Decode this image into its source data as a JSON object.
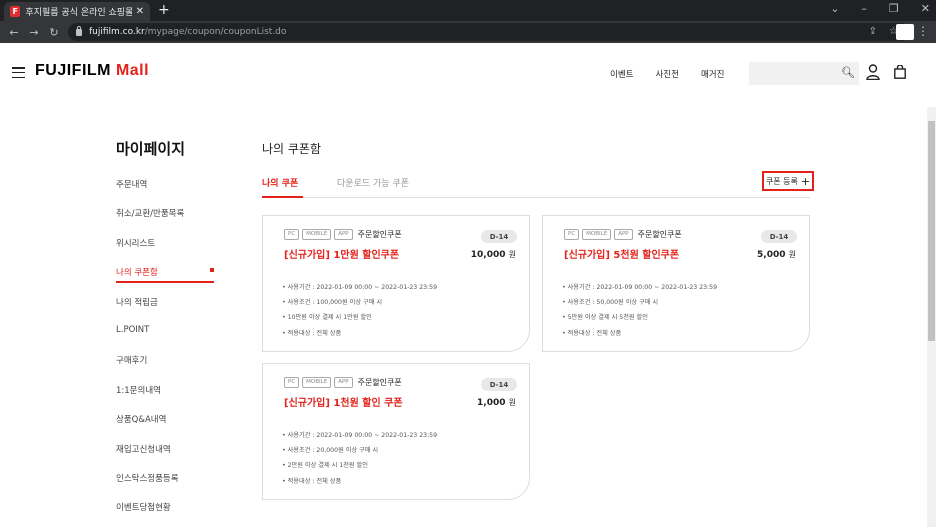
{
  "browser": {
    "tab_title": "후지필름 공식 온라인 쇼핑몰, 포",
    "favicon_letter": "F",
    "url_host": "fujifilm.co.kr",
    "url_path": "/mypage/coupon/couponList.do"
  },
  "header": {
    "logo_text": "FUJIFILM",
    "logo_mall": "Mall",
    "nav": [
      "이벤트",
      "사진전",
      "매거진"
    ],
    "accent_color": "#e3231b"
  },
  "sidebar": {
    "title": "마이페이지",
    "items": [
      "주문내역",
      "취소/교환/반품목록",
      "위시리스트",
      "나의 쿠폰함",
      "나의 적립금",
      "L.POINT",
      "구매후기",
      "1:1문의내역",
      "상품Q&A내역",
      "재입고신청내역",
      "인스탁스정품등록",
      "이벤트당첨현황"
    ],
    "active_index": 3
  },
  "main": {
    "title": "나의 쿠폰함",
    "tab_mine": "나의 쿠폰",
    "tab_download": "다운로드 가능 쿠폰",
    "register_label": "쿠폰 등록",
    "register_icon": "+"
  },
  "coupons": [
    {
      "tags": [
        "PC",
        "MOBILE",
        "APP"
      ],
      "type": "주문할인쿠폰",
      "dday": "D-14",
      "name": "[신규가입] 1만원 할인쿠폰",
      "amount": "10,000",
      "unit": "원",
      "details": [
        "• 사용기간 : 2022-01-09 00:00 ~ 2022-01-23 23:59",
        "• 사용조건 : 100,000원 이상 구매 시",
        "• 10만원 이상 결제 시 1만원 할인",
        "• 적용대상 : 전체 상품"
      ]
    },
    {
      "tags": [
        "PC",
        "MOBILE",
        "APP"
      ],
      "type": "주문할인쿠폰",
      "dday": "D-14",
      "name": "[신규가입] 5천원 할인쿠폰",
      "amount": "5,000",
      "unit": "원",
      "details": [
        "• 사용기간 : 2022-01-09 00:00 ~ 2022-01-23 23:59",
        "• 사용조건 : 50,000원 이상 구매 시",
        "• 5만원 이상 결제 시 5천원 할인",
        "• 적용대상 : 전체 상품"
      ]
    },
    {
      "tags": [
        "PC",
        "MOBILE",
        "APP"
      ],
      "type": "주문할인쿠폰",
      "dday": "D-14",
      "name": "[신규가입] 1천원 할인 쿠폰",
      "amount": "1,000",
      "unit": "원",
      "details": [
        "• 사용기간 : 2022-01-09 00:00 ~ 2022-01-23 23:59",
        "• 사용조건 : 20,000원 이상 구매 시",
        "• 2만원 이상 결제 시 1천원 할인",
        "• 적용대상 : 전체 상품"
      ]
    }
  ]
}
